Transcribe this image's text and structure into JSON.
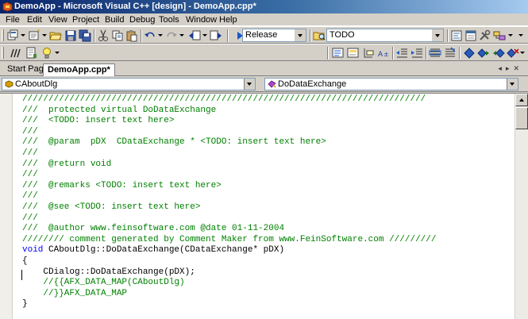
{
  "window": {
    "title": "DemoApp - Microsoft Visual C++ [design] - DemoApp.cpp*"
  },
  "menu": [
    "File",
    "Edit",
    "View",
    "Project",
    "Build",
    "Debug",
    "Tools",
    "Window",
    "Help"
  ],
  "toolbar1": {
    "config_value": "Release",
    "find_value": "TODO"
  },
  "tabs": {
    "items": [
      "Start Page",
      "DemoApp.cpp*"
    ],
    "active": "DemoApp.cpp*"
  },
  "nav": {
    "class_value": "CAboutDlg",
    "member_value": "DoDataExchange"
  },
  "code": {
    "lines": [
      {
        "type": "comment",
        "text": "/////////////////////////////////////////////////////////////////////////////"
      },
      {
        "type": "comment",
        "text": "///  protected virtual DoDataExchange"
      },
      {
        "type": "comment",
        "text": "///  <TODO: insert text here>"
      },
      {
        "type": "comment",
        "text": "///"
      },
      {
        "type": "comment",
        "text": "///  @param  pDX  CDataExchange * <TODO: insert text here>"
      },
      {
        "type": "comment",
        "text": "///"
      },
      {
        "type": "comment",
        "text": "///  @return void"
      },
      {
        "type": "comment",
        "text": "///"
      },
      {
        "type": "comment",
        "text": "///  @remarks <TODO: insert text here>"
      },
      {
        "type": "comment",
        "text": "///"
      },
      {
        "type": "comment",
        "text": "///  @see <TODO: insert text here>"
      },
      {
        "type": "comment",
        "text": "///"
      },
      {
        "type": "comment",
        "text": "///  @author www.feinsoftware.com @date 01-11-2004"
      },
      {
        "type": "comment",
        "text": "//////// comment generated by Comment Maker from www.FeinSoftware.com /////////"
      },
      {
        "type": "decl",
        "keyword": "void",
        "text": " CAboutDlg::DoDataExchange(CDataExchange* pDX)"
      },
      {
        "type": "plain",
        "text": "{"
      },
      {
        "type": "plain",
        "text": "    CDialog::DoDataExchange(pDX);"
      },
      {
        "type": "comment",
        "text": "    //{{AFX_DATA_MAP(CAboutDlg)"
      },
      {
        "type": "comment",
        "text": "    //}}AFX_DATA_MAP"
      },
      {
        "type": "plain",
        "text": "}"
      }
    ]
  },
  "colors": {
    "comment": "#008000",
    "keyword": "#0000ff",
    "title_gradient_start": "#0a246a",
    "title_gradient_end": "#a6caf0"
  }
}
